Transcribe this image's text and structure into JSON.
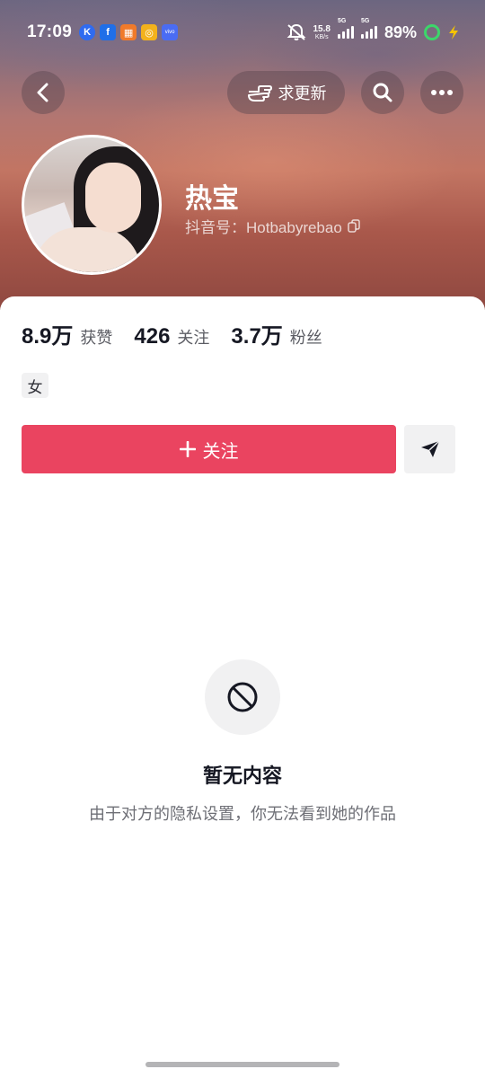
{
  "status_bar": {
    "time": "17:09",
    "app_icons": [
      {
        "name": "k-app-icon",
        "glyph": "K",
        "color": "#2f6bf0"
      },
      {
        "name": "facebook-icon",
        "glyph": "f",
        "color": "#1f6fe8"
      },
      {
        "name": "app-grid-icon",
        "glyph": "▦",
        "color": "#f07a2a"
      },
      {
        "name": "yellow-app-icon",
        "glyph": "◎",
        "color": "#f3b21c"
      },
      {
        "name": "vivo-icon",
        "glyph": "vivo",
        "color": "#4a6cf3"
      }
    ],
    "net_speed_value": "15.8",
    "net_speed_unit": "KB/s",
    "sim1_label": "5G",
    "sim2_label": "5G",
    "battery_percent": "89%"
  },
  "header": {
    "request_update_label": "求更新"
  },
  "profile": {
    "username": "热宝",
    "douyin_id": "抖音号：Hotbabyrebao",
    "gender_tag": "女"
  },
  "stats": [
    {
      "value": "8.9万",
      "label": "获赞"
    },
    {
      "value": "426",
      "label": "关注"
    },
    {
      "value": "3.7万",
      "label": "粉丝"
    }
  ],
  "actions": {
    "follow_label": "关注"
  },
  "empty_state": {
    "title": "暂无内容",
    "description": "由于对方的隐私设置，你无法看到她的作品"
  },
  "colors": {
    "accent": "#ea4460",
    "battery_ring": "#3cd66a"
  }
}
